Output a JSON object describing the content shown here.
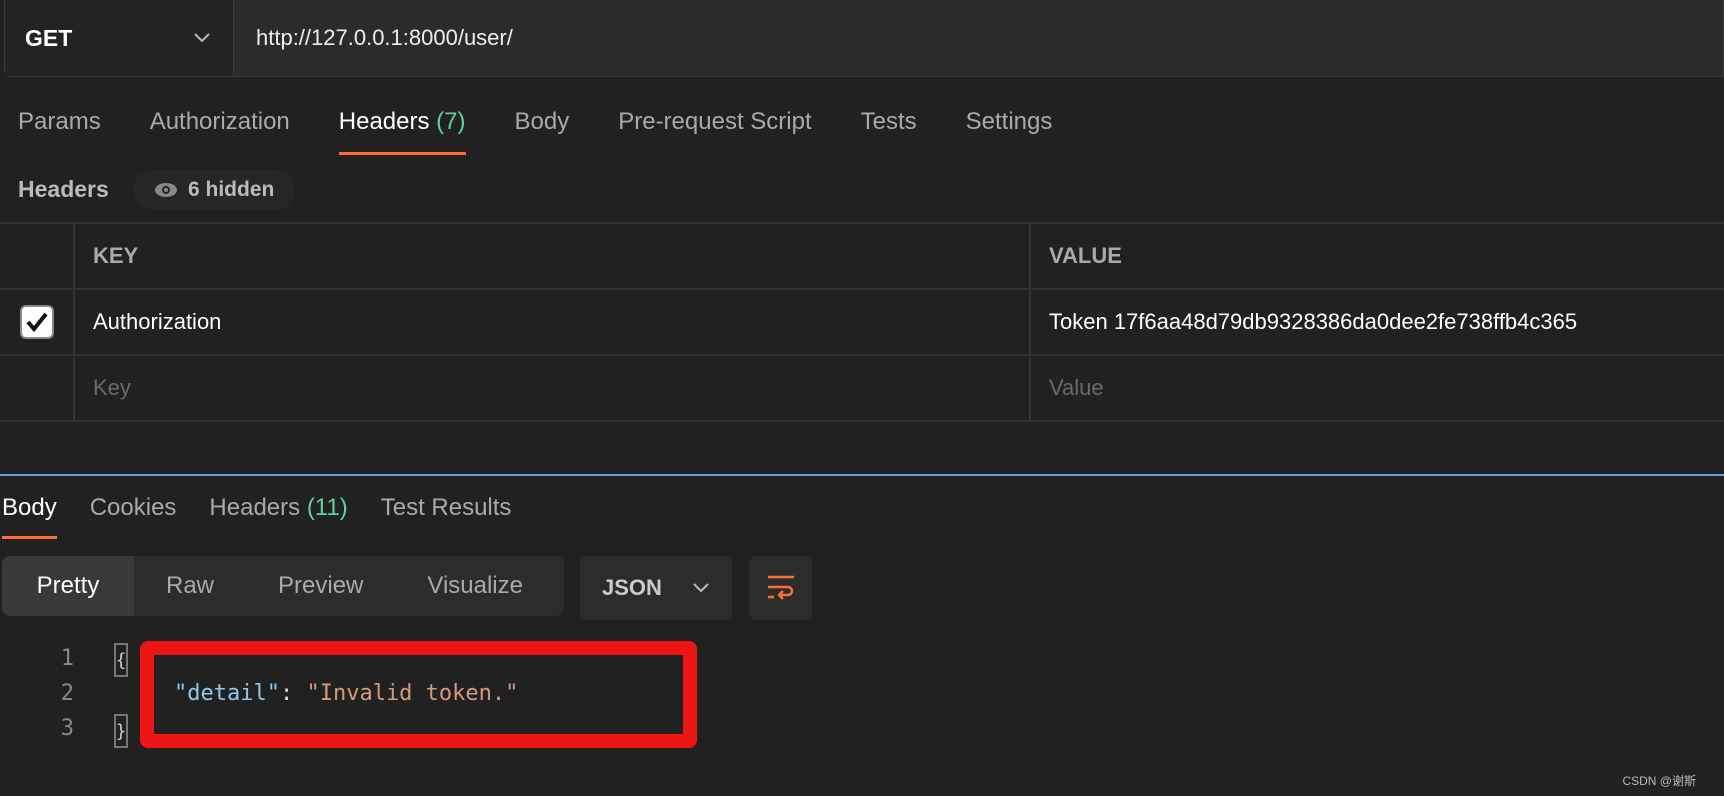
{
  "request": {
    "method": "GET",
    "url": "http://127.0.0.1:8000/user/"
  },
  "request_tabs": [
    {
      "label": "Params"
    },
    {
      "label": "Authorization"
    },
    {
      "label": "Headers",
      "count": "(7)"
    },
    {
      "label": "Body"
    },
    {
      "label": "Pre-request Script"
    },
    {
      "label": "Tests"
    },
    {
      "label": "Settings"
    }
  ],
  "headers_section": {
    "title": "Headers",
    "hidden": "6 hidden"
  },
  "headers_table": {
    "columns": [
      "KEY",
      "VALUE"
    ],
    "rows": [
      {
        "checked": true,
        "key": "Authorization",
        "value": "Token 17f6aa48d79db9328386da0dee2fe738ffb4c365"
      }
    ],
    "placeholder": {
      "key": "Key",
      "value": "Value"
    }
  },
  "response_tabs": [
    {
      "label": "Body"
    },
    {
      "label": "Cookies"
    },
    {
      "label": "Headers",
      "count": "(11)"
    },
    {
      "label": "Test Results"
    }
  ],
  "view_modes": [
    "Pretty",
    "Raw",
    "Preview",
    "Visualize"
  ],
  "format": "JSON",
  "code": {
    "line_numbers": [
      "1",
      "2",
      "3"
    ],
    "open": "{",
    "close": "}",
    "key": "\"detail\"",
    "colon": ": ",
    "value": "\"Invalid token.\""
  },
  "watermark": "CSDN @谢斯",
  "colors": {
    "accent": "#ff6c37",
    "count": "#5dd39e",
    "highlight": "#ee1515",
    "divider": "#6f9ee0"
  }
}
